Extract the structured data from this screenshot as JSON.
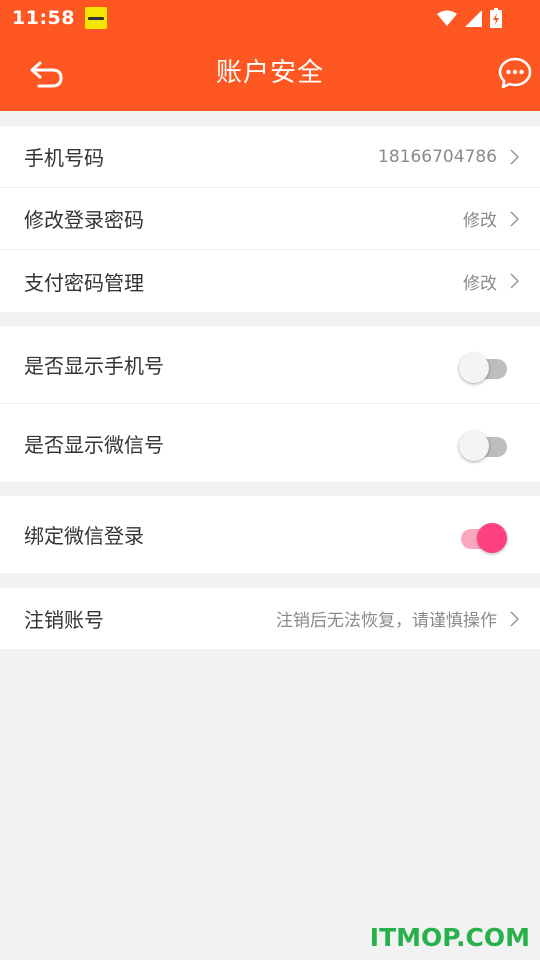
{
  "status_bar": {
    "time": "11:58"
  },
  "app_bar": {
    "title": "账户安全"
  },
  "groups": [
    {
      "rows": [
        {
          "label": "手机号码",
          "value": "18166704786"
        },
        {
          "label": "修改登录密码",
          "value": "修改"
        },
        {
          "label": "支付密码管理",
          "value": "修改"
        }
      ]
    },
    {
      "rows": [
        {
          "label": "是否显示手机号",
          "toggle_on": false
        },
        {
          "label": "是否显示微信号",
          "toggle_on": false
        }
      ]
    },
    {
      "rows": [
        {
          "label": "绑定微信登录",
          "toggle_on": true
        }
      ]
    },
    {
      "rows": [
        {
          "label": "注销账号",
          "value": "注销后无法恢复，请谨慎操作"
        }
      ]
    }
  ],
  "watermark": "ITMOP.COM",
  "colors": {
    "primary": "#ff5722",
    "accent": "#ff4081",
    "background": "#f2f2f2"
  },
  "icons": [
    "back-icon",
    "message-icon",
    "wifi-icon",
    "signal-icon",
    "battery-icon",
    "chevron-right-icon",
    "notification-icon"
  ]
}
